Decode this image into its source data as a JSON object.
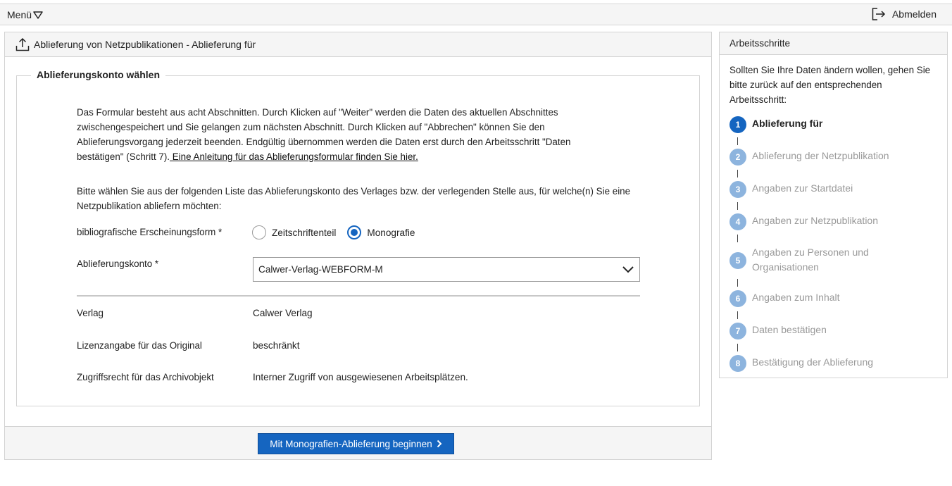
{
  "topbar": {
    "menu_label": "Menü",
    "logout_label": "Abmelden"
  },
  "main": {
    "header_title": "Ablieferung von Netzpublikationen - Ablieferung für",
    "section_title": "Ablieferungskonto wählen",
    "intro_text": "Das Formular besteht aus acht Abschnitten. Durch Klicken auf \"Weiter\" werden die Daten des aktuellen Abschnittes zwischengespeichert und Sie gelangen zum nächsten Abschnitt. Durch Klicken auf \"Abbrechen\" können Sie den Ablieferungsvorgang jederzeit beenden. Endgültig übernommen werden die Daten erst durch den Arbeitsschritt \"Daten bestätigen\" (Schritt 7).",
    "intro_link": " Eine Anleitung für das Ablieferungsformular finden Sie hier.",
    "choose_text": "Bitte wählen Sie aus der folgenden Liste das Ablieferungskonto des Verlages bzw. der verlegenden Stelle aus, für welche(n) Sie eine Netzpublikation abliefern möchten:",
    "form_label": "bibliografische Erscheinungsform *",
    "radio_options": [
      "Zeitschriftenteil",
      "Monografie"
    ],
    "radio_selected": "Monografie",
    "account_label": "Ablieferungskonto *",
    "account_value": "Calwer-Verlag-WEBFORM-M",
    "info_rows": [
      {
        "label": "Verlag",
        "value": "Calwer Verlag"
      },
      {
        "label": "Lizenzangabe für das Original",
        "value": "beschränkt"
      },
      {
        "label": "Zugriffsrecht für das Archivobjekt",
        "value": "Interner Zugriff von ausgewiesenen Arbeitsplätzen."
      }
    ],
    "start_button": "Mit Monografien-Ablieferung beginnen"
  },
  "sidebar": {
    "title": "Arbeitsschritte",
    "note": "Sollten Sie Ihre Daten ändern wollen, gehen Sie bitte zurück auf den entsprechenden Arbeitsschritt:",
    "steps": [
      {
        "num": "1",
        "label": "Ablieferung für",
        "active": true
      },
      {
        "num": "2",
        "label": "Ablieferung der Netzpublikation",
        "active": false
      },
      {
        "num": "3",
        "label": "Angaben zur Startdatei",
        "active": false
      },
      {
        "num": "4",
        "label": "Angaben zur Netzpublikation",
        "active": false
      },
      {
        "num": "5",
        "label": "Angaben zu Personen und Organisationen",
        "active": false
      },
      {
        "num": "6",
        "label": "Angaben zum Inhalt",
        "active": false
      },
      {
        "num": "7",
        "label": "Daten bestätigen",
        "active": false
      },
      {
        "num": "8",
        "label": "Bestätigung der Ablieferung",
        "active": false
      }
    ]
  },
  "colors": {
    "accent": "#1565c0",
    "step_inactive": "#8db4de",
    "header_bg": "#f5f5f5"
  },
  "icons": [
    "chevron-down-icon",
    "logout-icon",
    "upload-icon",
    "chevron-right-icon"
  ]
}
